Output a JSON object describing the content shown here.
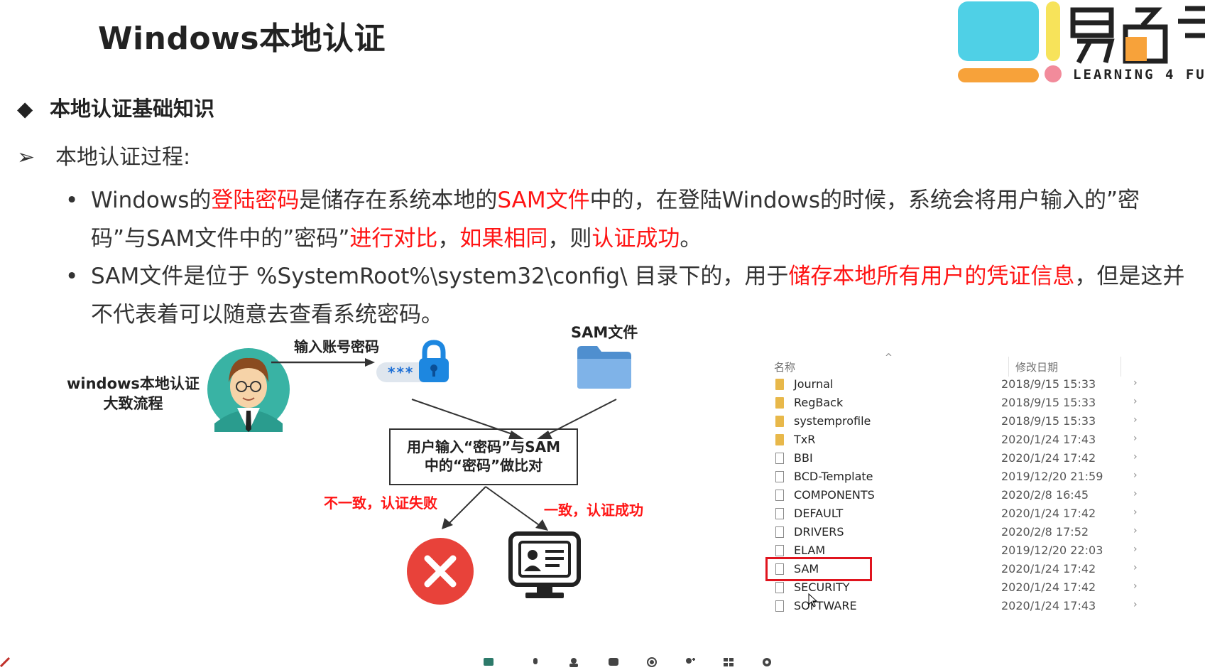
{
  "slide": {
    "title": "Windows本地认证",
    "section": "本地认证基础知识",
    "subsection": "本地认证过程:",
    "bullet1": [
      {
        "t": "Windows的",
        "red": false
      },
      {
        "t": "登陆密码",
        "red": true
      },
      {
        "t": "是储存在系统本地的",
        "red": false
      },
      {
        "t": "SAM文件",
        "red": true
      },
      {
        "t": "中的，在登陆Windows的时候，系统会将用户输入的”密码”与SAM文件中的”密码”",
        "red": false
      },
      {
        "t": "进行对比",
        "red": true
      },
      {
        "t": "，",
        "red": false
      },
      {
        "t": "如果相同",
        "red": true
      },
      {
        "t": "，则",
        "red": false
      },
      {
        "t": "认证成功",
        "red": true
      },
      {
        "t": "。",
        "red": false
      }
    ],
    "bullet2": [
      {
        "t": "SAM文件是位于 %SystemRoot%\\system32\\config\\ 目录下的，用于",
        "red": false
      },
      {
        "t": "储存本地所有用户的凭证信息",
        "red": true
      },
      {
        "t": "，但是这并不代表着可以随意去查看系统密码。",
        "red": false
      }
    ]
  },
  "logo": {
    "tagline": "LEARNING 4 FU",
    "colors": {
      "cyan": "#4fd0e6",
      "orange": "#f7a23a",
      "yellow": "#f7e35a",
      "pink": "#f28b9b",
      "dark": "#222222"
    }
  },
  "diagram": {
    "flow_title": "windows本地认证\n大致流程",
    "input_label": "输入账号密码",
    "password_mask": "***",
    "sam_label": "SAM文件",
    "compare_box": "用户输入“密码”与SAM\n中的“密码”做比对",
    "fail_label": "不一致，认证失败",
    "success_label": "一致，认证成功"
  },
  "explorer": {
    "col_name": "名称",
    "col_date": "修改日期",
    "rows": [
      {
        "name": "Journal",
        "date": "2018/9/15 15:33",
        "type": "folder"
      },
      {
        "name": "RegBack",
        "date": "2018/9/15 15:33",
        "type": "folder"
      },
      {
        "name": "systemprofile",
        "date": "2018/9/15 15:33",
        "type": "folder"
      },
      {
        "name": "TxR",
        "date": "2020/1/24 17:43",
        "type": "folder"
      },
      {
        "name": "BBI",
        "date": "2020/1/24 17:42",
        "type": "file"
      },
      {
        "name": "BCD-Template",
        "date": "2019/12/20 21:59",
        "type": "file"
      },
      {
        "name": "COMPONENTS",
        "date": "2020/2/8 16:45",
        "type": "file"
      },
      {
        "name": "DEFAULT",
        "date": "2020/1/24 17:42",
        "type": "file"
      },
      {
        "name": "DRIVERS",
        "date": "2020/2/8 17:52",
        "type": "file"
      },
      {
        "name": "ELAM",
        "date": "2019/12/20 22:03",
        "type": "file"
      },
      {
        "name": "SAM",
        "date": "2020/1/24 17:42",
        "type": "file",
        "selected": true
      },
      {
        "name": "SECURITY",
        "date": "2020/1/24 17:42",
        "type": "file"
      },
      {
        "name": "SOFTWARE",
        "date": "2020/1/24 17:43",
        "type": "file"
      }
    ]
  }
}
